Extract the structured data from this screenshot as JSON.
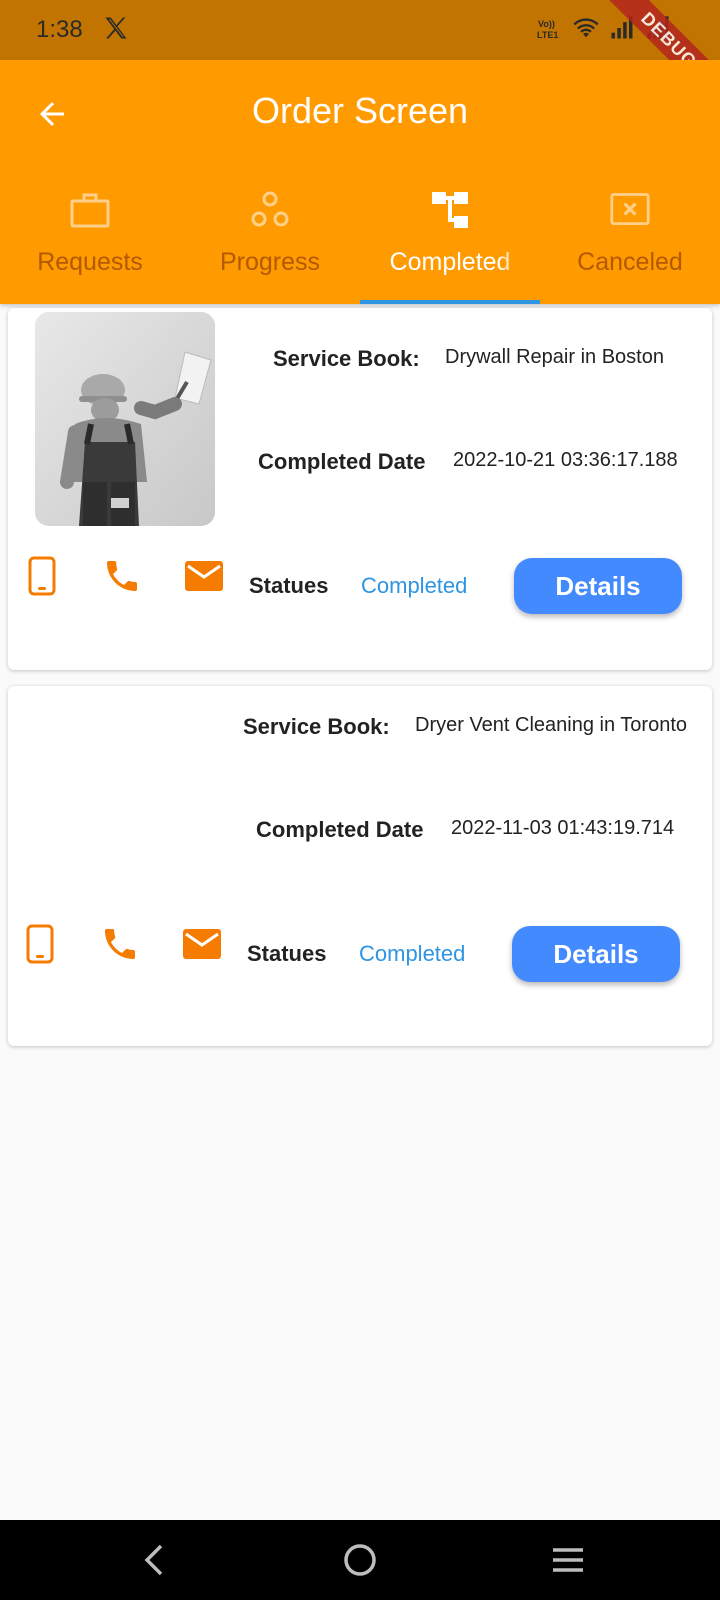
{
  "status_bar": {
    "time": "1:38",
    "debug_label": "DEBUG"
  },
  "app_bar": {
    "title": "Order Screen"
  },
  "tabs": [
    {
      "label": "Requests",
      "icon": "briefcase-icon",
      "active": false
    },
    {
      "label": "Progress",
      "icon": "bubbles-icon",
      "active": false
    },
    {
      "label": "Completed",
      "icon": "tree-icon",
      "active": true
    },
    {
      "label": "Canceled",
      "icon": "cancel-box-icon",
      "active": false
    }
  ],
  "orders": [
    {
      "service_label": "Service Book:",
      "service_value": "Drywall Repair in Boston",
      "date_label": "Completed Date",
      "date_value": "2022-10-21 03:36:17.188",
      "statues_label": "Statues",
      "statues_value": "Completed",
      "details_label": "Details",
      "has_photo": true
    },
    {
      "service_label": "Service Book:",
      "service_value": "Dryer Vent Cleaning in Toronto",
      "date_label": "Completed Date",
      "date_value": "2022-11-03 01:43:19.714",
      "statues_label": "Statues",
      "statues_value": "Completed",
      "details_label": "Details",
      "has_photo": false
    }
  ],
  "colors": {
    "app_bar": "#ff9a00",
    "status_bar": "#c17500",
    "accent_orange": "#f57c00",
    "button_blue": "#448aff",
    "status_blue": "#2e95e3"
  }
}
